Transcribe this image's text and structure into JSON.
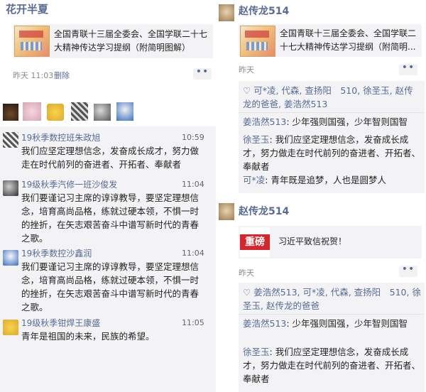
{
  "left": {
    "title": "花开半夏",
    "share_text": "全国青联十三届全委会、全国学联二十七大精神传达学习提纲（附简明图解）",
    "time": "昨天 11:03",
    "delete_label": "删除",
    "more_label": "••",
    "messages": [
      {
        "name": "19秋季数控班朱政旭",
        "time": "10:59",
        "text": "我们应坚定理想信念，发奋成长成才，努力做走在时代前列的奋进者、开拓者、奉献者"
      },
      {
        "name": "19级秋季汽修一班沙俊发",
        "time": "11:04",
        "text": "我们要谨记习主席的谆谆教导，要坚定理想信念，培育高尚品格，练就过硬本领，不惧一时的挫折，在矢志艰苦奋斗中谱写新时代的青春之歌。"
      },
      {
        "name": "19秋季数控沙鑫润",
        "time": "11:04",
        "text": "我们要谨记习主席的谆谆教导，要坚定理想信念，培育高尚品格，练就过硬本领，不惧一时的挫折，在矢志艰苦奋斗中谱写新时代的青春之歌。"
      },
      {
        "name": "19级秋季钳焊王康盛",
        "time": "11:05",
        "text": "青年是祖国的未来，民族的希望。"
      }
    ]
  },
  "right_top": {
    "user": "赵传龙514",
    "share_text": "全国青联十三届全委会、全国学联二十七大精神传达学习提纲（附简明...",
    "time": "昨天",
    "more_label": "••",
    "likes_prefix": "♡ ",
    "likes": "可*凌, 代森, 查扬阳　510, 徐圣玉, 赵传龙的爸爸, 姜浩然513",
    "comments": [
      {
        "name": "姜浩然513",
        "text": "少年强则国强，少年智则国智"
      },
      {
        "name": "徐圣玉",
        "text": "我们应坚定理想信念，发奋成长成才，努力做走在时代前列的奋进者、开拓者、奉献者"
      },
      {
        "name": "可*凌",
        "text": "青年既是追梦，人也是圆梦人"
      }
    ]
  },
  "right_bottom": {
    "user": "赵传龙514",
    "badge": "重磅",
    "share_text": "习近平致信祝贺！",
    "time": "昨天",
    "more_label": "••",
    "likes_prefix": "♡ ",
    "likes": "姜浩然513, 可*凌, 代森, 查扬阳　510, 徐圣玉, 赵传龙的爸爸",
    "comments": [
      {
        "name": "姜浩然513",
        "text": "少年强则国强，少年智则国智"
      },
      {
        "name": "徐圣玉",
        "text": "我们应坚定理想信念，发奋成长成才，努力做走在时代前列的奋进者、开拓者、奉献者"
      }
    ]
  },
  "colors": {
    "link": "#576b95",
    "comment_bg": "#f3f3f5",
    "badge_red": "#d7262b"
  },
  "icons": [
    "heart-icon",
    "more-icon",
    "avatar-icon"
  ]
}
